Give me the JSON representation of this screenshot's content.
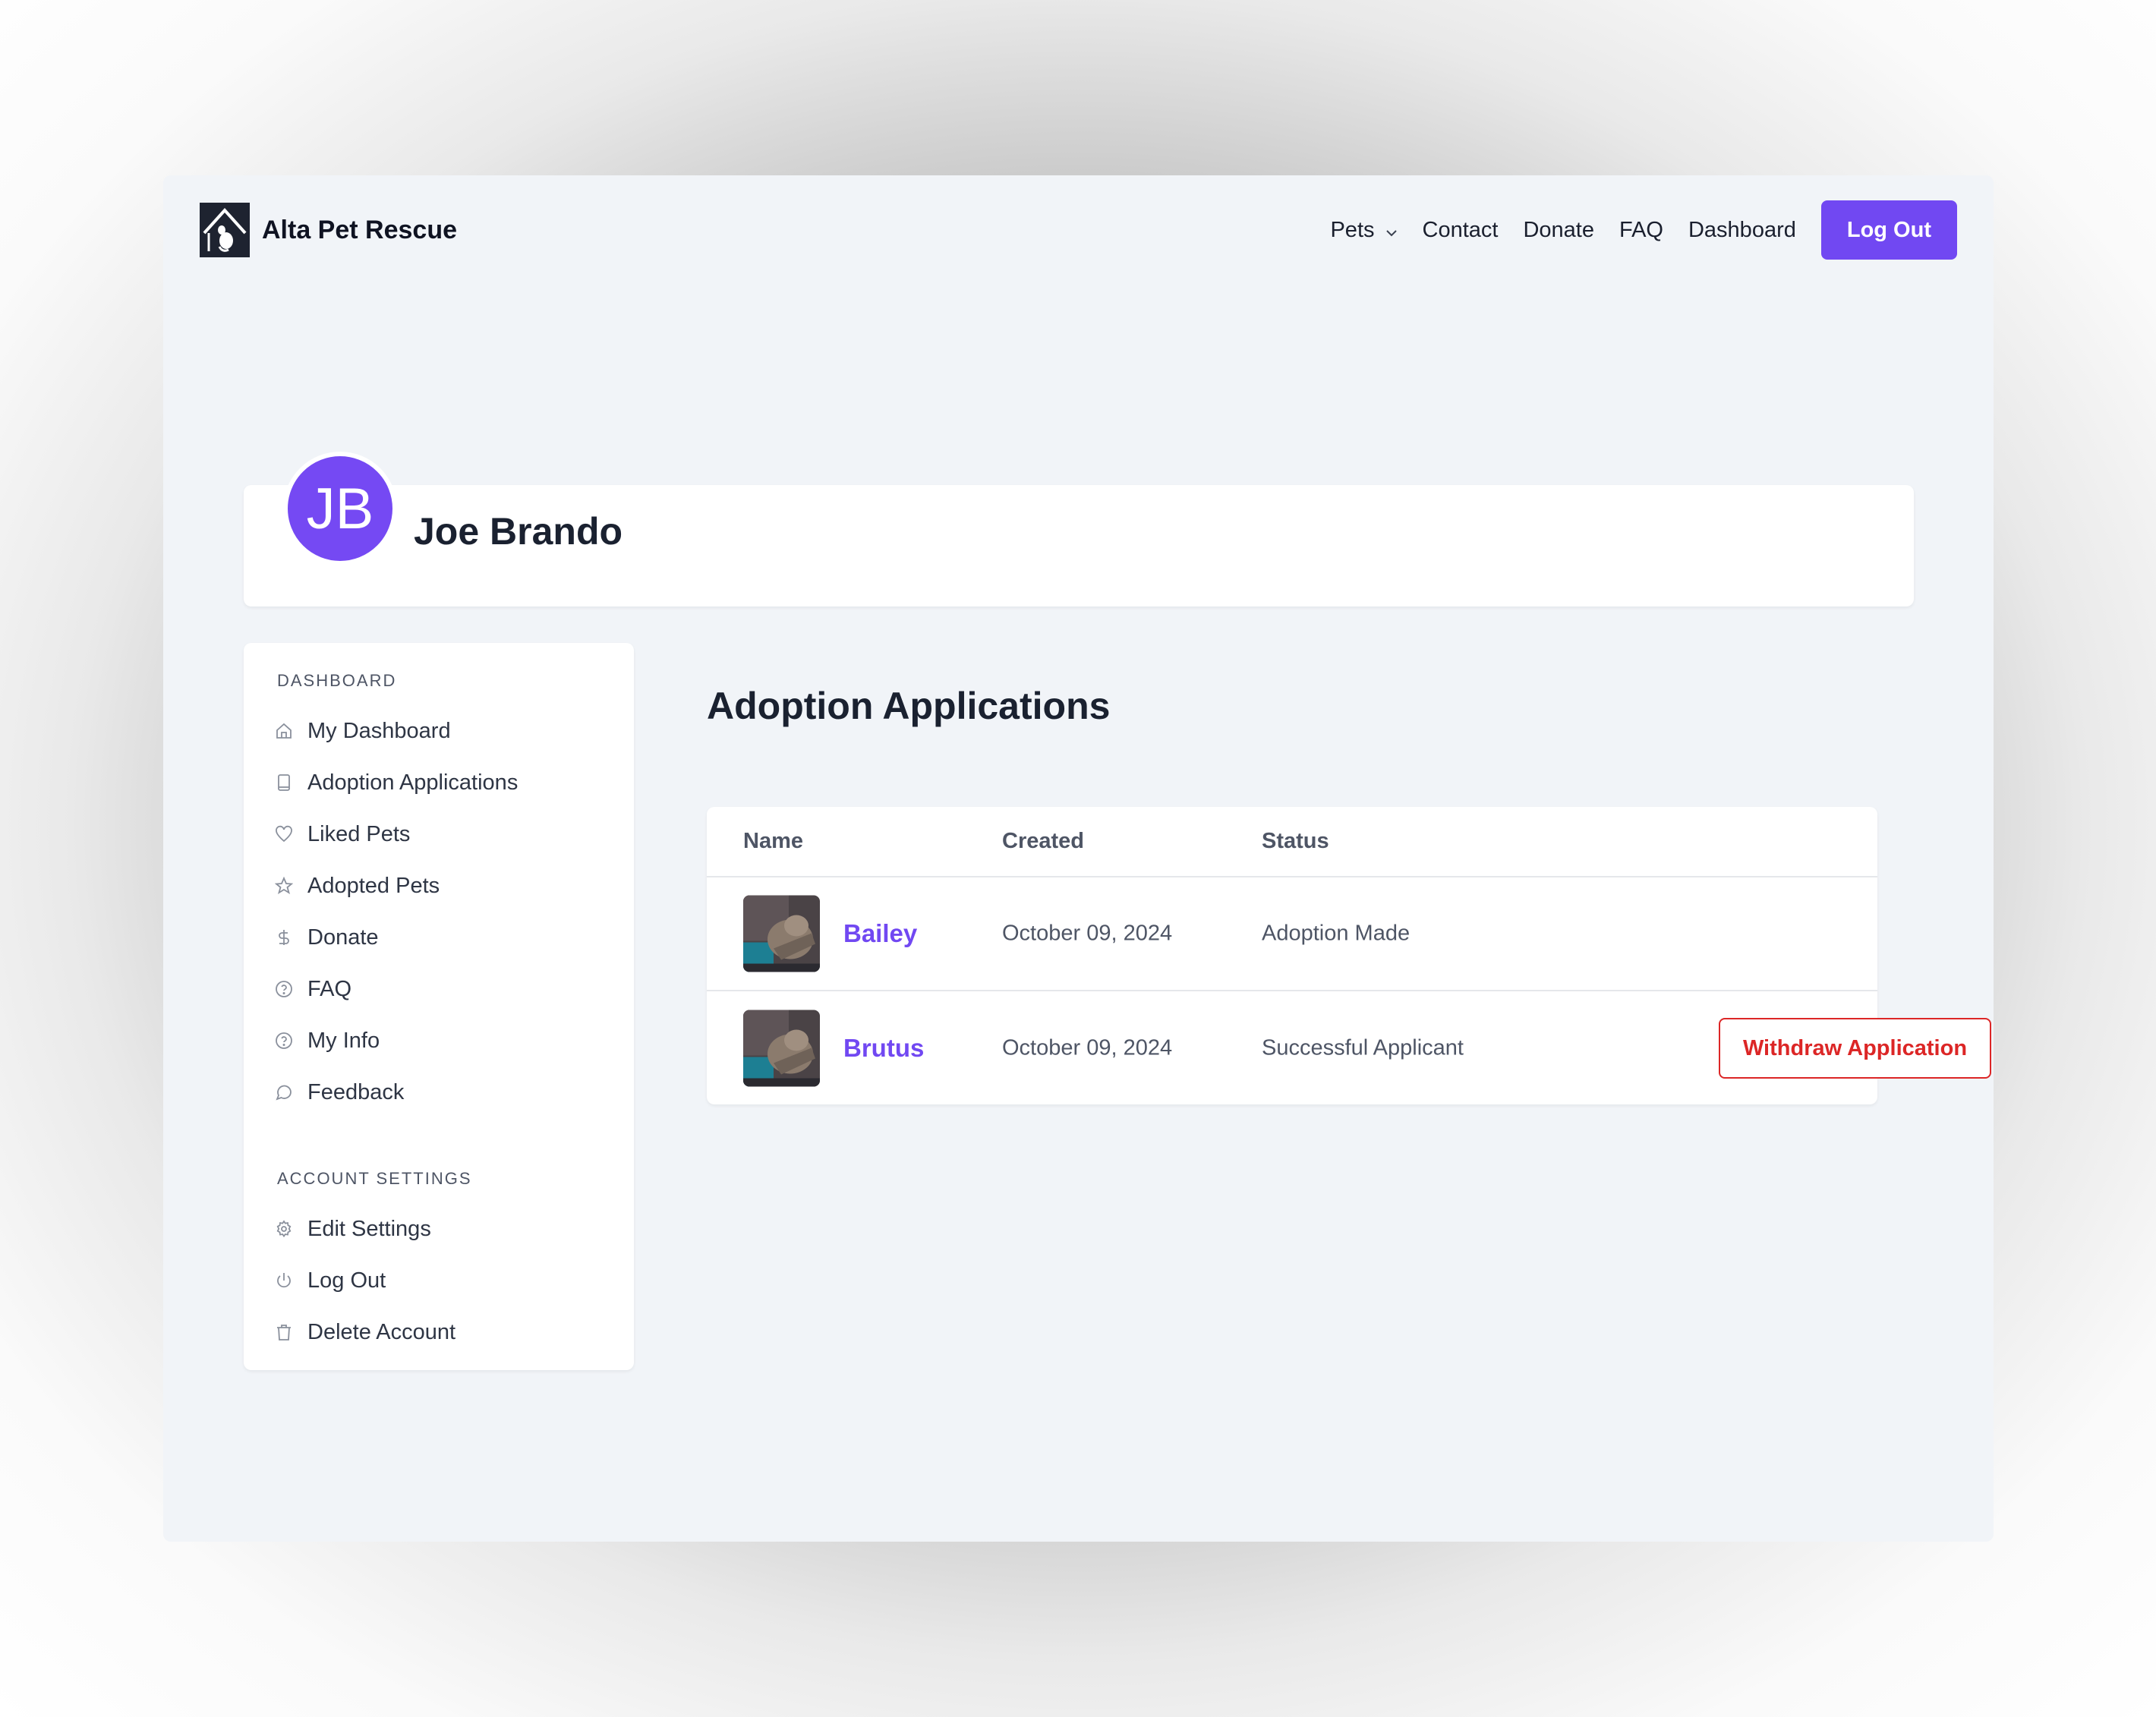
{
  "brand": {
    "name": "Alta Pet Rescue",
    "logo_icon": "house-pet-logo"
  },
  "nav": {
    "items": [
      {
        "label": "Pets",
        "has_dropdown": true
      },
      {
        "label": "Contact"
      },
      {
        "label": "Donate"
      },
      {
        "label": "FAQ"
      },
      {
        "label": "Dashboard"
      }
    ],
    "logout_label": "Log Out"
  },
  "profile": {
    "initials": "JB",
    "name": "Joe Brando"
  },
  "sidebar": {
    "dashboard_heading": "DASHBOARD",
    "dashboard_items": [
      {
        "label": "My Dashboard",
        "icon": "home-icon"
      },
      {
        "label": "Adoption Applications",
        "icon": "book-icon"
      },
      {
        "label": "Liked Pets",
        "icon": "heart-icon"
      },
      {
        "label": "Adopted Pets",
        "icon": "star-icon"
      },
      {
        "label": "Donate",
        "icon": "dollar-icon"
      },
      {
        "label": "FAQ",
        "icon": "question-circle-icon"
      },
      {
        "label": "My Info",
        "icon": "question-circle-icon"
      },
      {
        "label": "Feedback",
        "icon": "chat-bubble-icon"
      }
    ],
    "account_heading": "ACCOUNT SETTINGS",
    "account_items": [
      {
        "label": "Edit Settings",
        "icon": "gear-icon"
      },
      {
        "label": "Log Out",
        "icon": "power-icon"
      },
      {
        "label": "Delete Account",
        "icon": "trash-icon"
      }
    ]
  },
  "main": {
    "title": "Adoption Applications",
    "table": {
      "headers": {
        "name": "Name",
        "created": "Created",
        "status": "Status"
      },
      "rows": [
        {
          "name": "Bailey",
          "created": "October 09, 2024",
          "status": "Adoption Made"
        },
        {
          "name": "Brutus",
          "created": "October 09, 2024",
          "status": "Successful Applicant",
          "action": "Withdraw Application"
        }
      ]
    }
  },
  "colors": {
    "accent": "#7148f2",
    "danger": "#dc2626",
    "page_bg": "#f1f4f8",
    "text_dark": "#1a2130",
    "text_muted": "#4e5565"
  }
}
